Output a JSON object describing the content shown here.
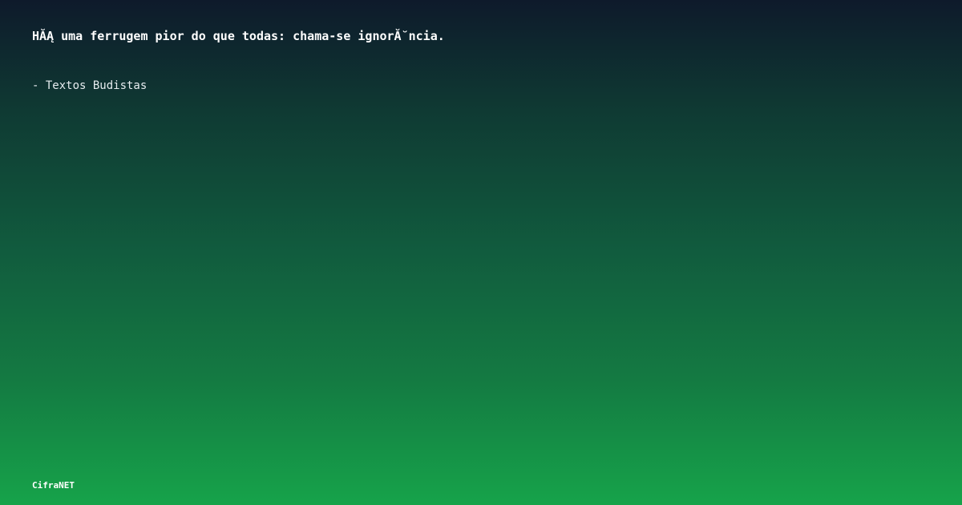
{
  "quote": {
    "text": "HĂĄ uma ferrugem pior do que todas: chama-se ignorĂ˘ncia.",
    "author": "- Textos Budistas"
  },
  "brand": {
    "name": "CifraNET"
  },
  "colors": {
    "gradient_top": "#0e1a2b",
    "gradient_bottom": "#16a34a",
    "text": "#ffffff"
  }
}
